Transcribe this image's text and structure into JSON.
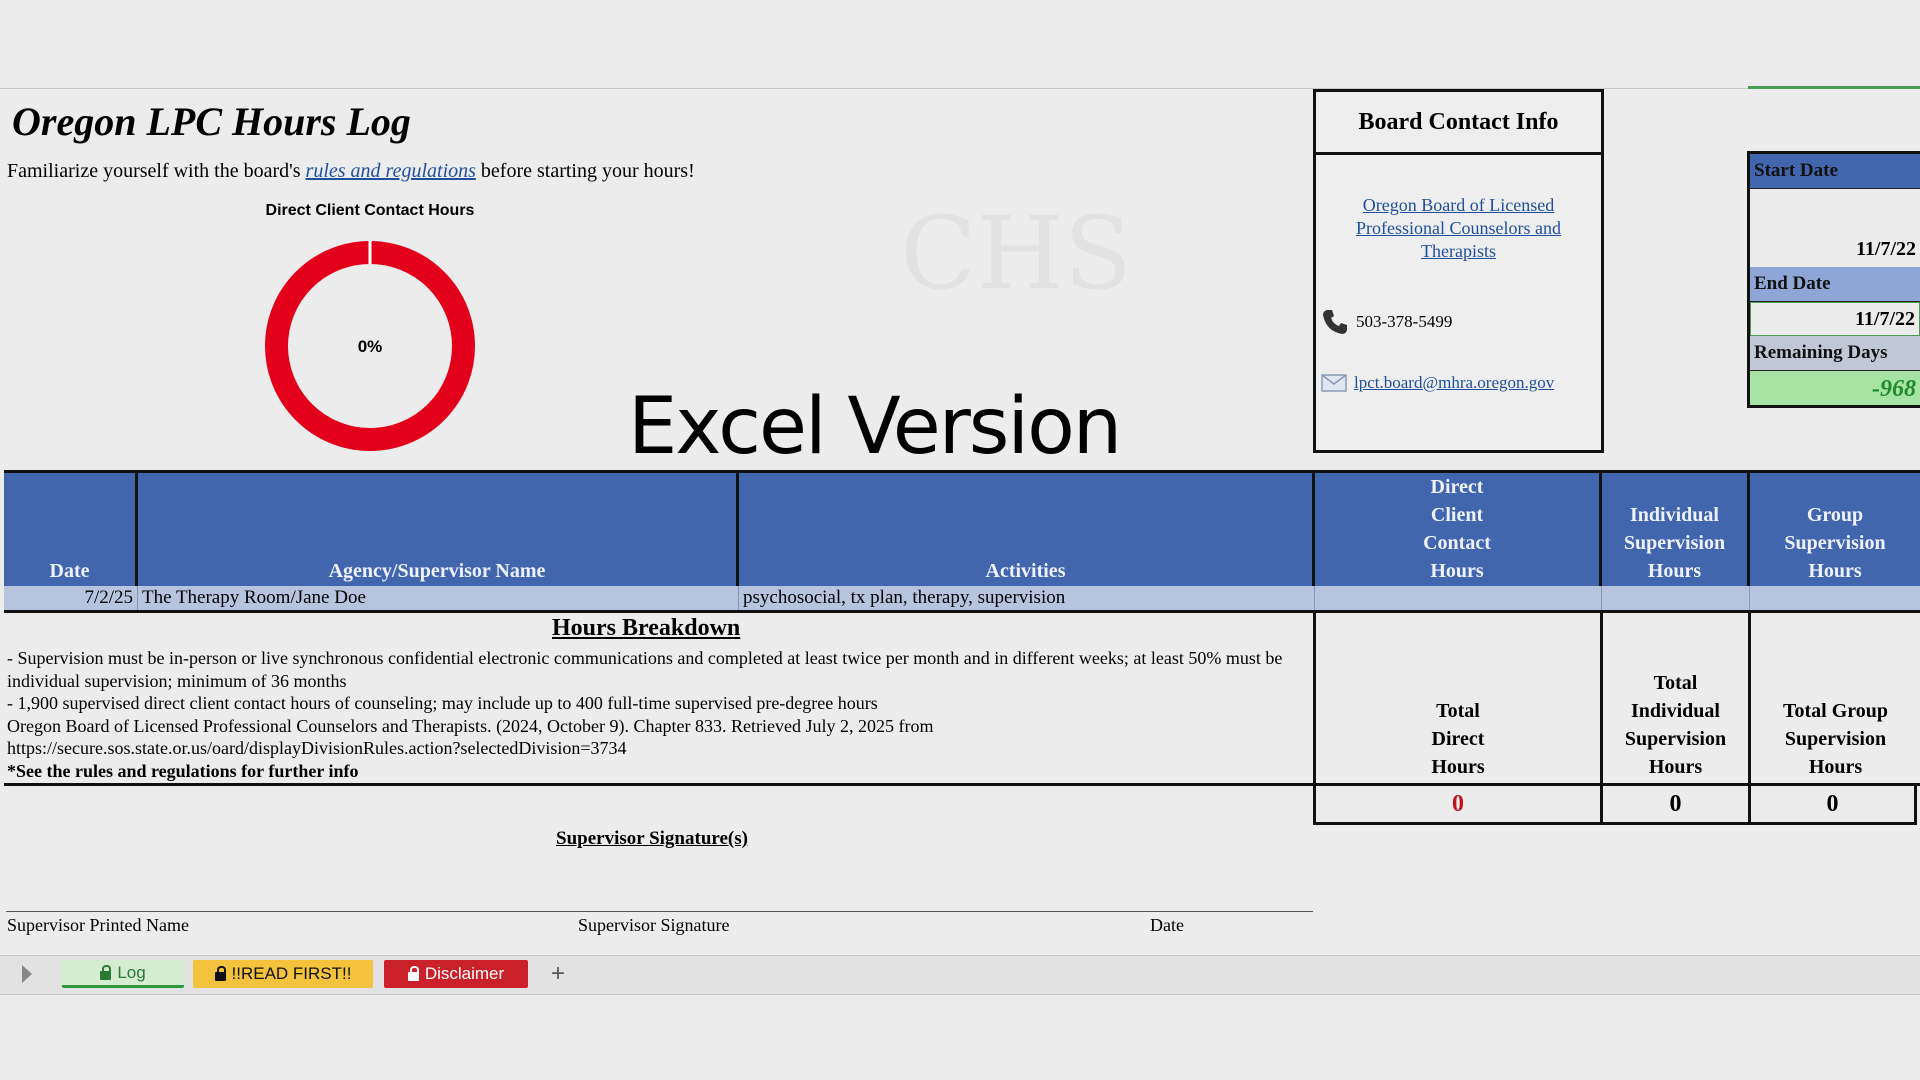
{
  "header": {
    "title": "Oregon LPC Hours Log",
    "subtitle_before": "Familiarize yourself with the board's ",
    "subtitle_link": "rules and regulations",
    "subtitle_after": " before starting your hours!",
    "overlay_text": "Excel Version",
    "watermark": "CHS"
  },
  "chart_data": {
    "type": "pie",
    "title": "Direct Client Contact Hours",
    "center_label": "0%",
    "values": [
      0,
      100
    ],
    "colors": [
      "#2e8b3a",
      "#e3001b"
    ]
  },
  "board": {
    "title": "Board Contact Info",
    "link": "Oregon Board of Licensed Professional Counselors and Therapists",
    "phone": "503-378-5499",
    "email": "lpct.board@mhra.oregon.gov"
  },
  "dates": {
    "start_label": "Start Date",
    "start_value": "11/7/22",
    "end_label": "End Date",
    "end_value": "11/7/22",
    "remaining_label": "Remaining Days",
    "remaining_value": "-968"
  },
  "table": {
    "headers": {
      "date": "Date",
      "agency": "Agency/Supervisor Name",
      "activities": "Activities",
      "direct": "Direct Client Contact Hours",
      "individual": "Individual Supervision Hours",
      "group": "Group Supervision Hours"
    },
    "rows": [
      {
        "date": "7/2/25",
        "agency": "The Therapy Room/Jane Doe",
        "activities": "psychosocial, tx plan, therapy, supervision",
        "direct": "",
        "individual": "",
        "group": ""
      }
    ]
  },
  "breakdown": {
    "title": "Hours Breakdown",
    "line1": "- Supervision must be in-person or live synchronous confidential electronic communications and completed at least twice per month and in different weeks; at least 50% must be individual supervision; minimum of 36 months",
    "line2": "- 1,900 supervised direct client contact hours of counseling; may include up to 400 full-time supervised pre-degree hours",
    "line3": "Oregon Board of Licensed Professional Counselors and Therapists. (2024, October 9). Chapter 833. Retrieved July 2, 2025 from https://secure.sos.state.or.us/oard/displayDivisionRules.action?selectedDivision=3734",
    "line4": "*See the rules and regulations for further info"
  },
  "totals": {
    "direct_label": "Total Direct Hours",
    "individual_label": "Total Individual Supervision Hours",
    "group_label": "Total Group Supervision Hours",
    "direct_value": "0",
    "individual_value": "0",
    "group_value": "0"
  },
  "signature": {
    "title": "Supervisor Signature(s)",
    "printed_name": "Supervisor Printed Name",
    "signature": "Supervisor Signature",
    "date": "Date"
  },
  "tabs": {
    "log": "Log",
    "read_first": "!!READ FIRST!!",
    "disclaimer": "Disclaimer",
    "add": "+"
  }
}
